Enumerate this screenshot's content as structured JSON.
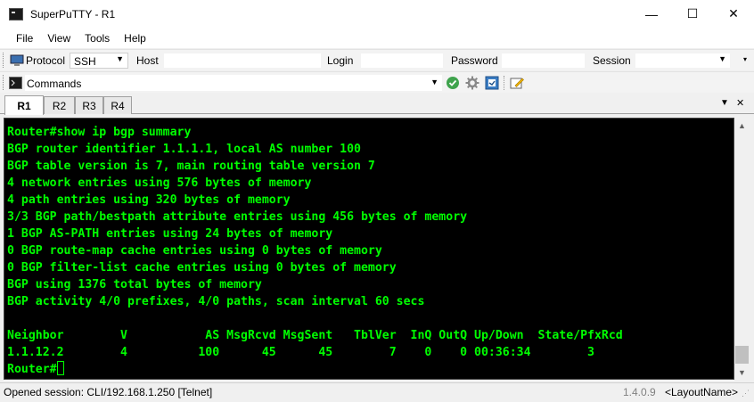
{
  "window": {
    "title": "SuperPuTTY - R1",
    "minimize_glyph": "—",
    "maximize_glyph": "☐",
    "close_glyph": "✕"
  },
  "menu": [
    "File",
    "View",
    "Tools",
    "Help"
  ],
  "connection_bar": {
    "protocol_label": "Protocol",
    "protocol_value": "SSH",
    "host_label": "Host",
    "host_value": "",
    "login_label": "Login",
    "login_value": "",
    "password_label": "Password",
    "password_value": "",
    "session_label": "Session",
    "session_value": ""
  },
  "commands_bar": {
    "label": "Commands",
    "value": ""
  },
  "tabs": [
    {
      "label": "R1",
      "active": true
    },
    {
      "label": "R2",
      "active": false
    },
    {
      "label": "R3",
      "active": false
    },
    {
      "label": "R4",
      "active": false
    }
  ],
  "terminal": {
    "color": "#00ff00",
    "lines": [
      "Router#show ip bgp summary",
      "BGP router identifier 1.1.1.1, local AS number 100",
      "BGP table version is 7, main routing table version 7",
      "4 network entries using 576 bytes of memory",
      "4 path entries using 320 bytes of memory",
      "3/3 BGP path/bestpath attribute entries using 456 bytes of memory",
      "1 BGP AS-PATH entries using 24 bytes of memory",
      "0 BGP route-map cache entries using 0 bytes of memory",
      "0 BGP filter-list cache entries using 0 bytes of memory",
      "BGP using 1376 total bytes of memory",
      "BGP activity 4/0 prefixes, 4/0 paths, scan interval 60 secs",
      "",
      "Neighbor        V           AS MsgRcvd MsgSent   TblVer  InQ OutQ Up/Down  State/PfxRcd",
      "1.1.12.2        4          100      45      45        7    0    0 00:36:34        3"
    ],
    "prompt": "Router#"
  },
  "status": {
    "message": "Opened session: CLI/192.168.1.250 [Telnet]",
    "version": "1.4.0.9",
    "layout": "<LayoutName>"
  }
}
